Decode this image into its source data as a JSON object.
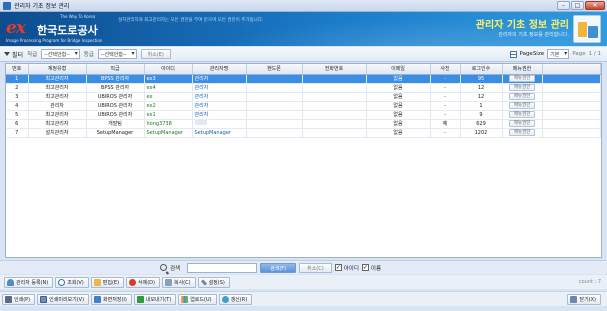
{
  "window": {
    "title": "관리자 기초 정보 관리"
  },
  "banner": {
    "logo_ex": "ex",
    "logo_kor": "한국도로공사",
    "logo_tag": "The Way To Korea",
    "logo_eng": "Image Processing Program for Bridge Inspection",
    "message": "설치관리자와 최고관리자는 모든 권한을 부여 받으며 모든 권한이 추가됩니다.",
    "title": "관리자 기초 정보 관리",
    "subtitle": "관리자의 기초 정보를 관리합니다."
  },
  "filter": {
    "filter_label": "필터",
    "rank_label": "직급",
    "rank_value": "--선택안함--",
    "level_label": "등급",
    "level_value": "--선택안함--",
    "cancel_label": "취소(E)",
    "pagesize_label": "PageSize",
    "pagesize_value": "기본",
    "page_label": "Page",
    "page_value": "1 / 1"
  },
  "table": {
    "headers": [
      "번호",
      "계정유형",
      "직급",
      "아이디",
      "관리자명",
      "핸드폰",
      "전화번호",
      "이메일",
      "사진",
      "로그인수",
      "메뉴권한"
    ],
    "rows": [
      {
        "no": "1",
        "type": "최고관리자",
        "rank": "BPSS 관리자",
        "id": "ex3",
        "name": "관리자",
        "phone": "",
        "tel": "",
        "email": "없음",
        "photo": "-",
        "logins": "95",
        "menu": "메뉴권한"
      },
      {
        "no": "2",
        "type": "최고관리자",
        "rank": "BPSS 관리자",
        "id": "ex4",
        "name": "관리자",
        "phone": "",
        "tel": "",
        "email": "없음",
        "photo": "-",
        "logins": "12",
        "menu": "메뉴권한"
      },
      {
        "no": "3",
        "type": "최고관리자",
        "rank": "UBIROS 관리자",
        "id": "ex",
        "name": "관리자",
        "phone": "",
        "tel": "",
        "email": "없음",
        "photo": "-",
        "logins": "12",
        "menu": "메뉴권한"
      },
      {
        "no": "4",
        "type": "관리자",
        "rank": "UBIROS 관리자",
        "id": "ex2",
        "name": "관리자",
        "phone": "",
        "tel": "",
        "email": "없음",
        "photo": "-",
        "logins": "1",
        "menu": "메뉴권한"
      },
      {
        "no": "5",
        "type": "최고관리자",
        "rank": "UBIROS 관리자",
        "id": "ex1",
        "name": "관리자",
        "phone": "",
        "tel": "",
        "email": "없음",
        "photo": "-",
        "logins": "9",
        "menu": "메뉴권한"
      },
      {
        "no": "6",
        "type": "최고관리자",
        "rank": "개발팀",
        "id": "hong3738",
        "name": "",
        "phone": "",
        "tel": "",
        "email": "없음",
        "photo": "예",
        "logins": "629",
        "menu": "메뉴권한"
      },
      {
        "no": "7",
        "type": "설치관리자",
        "rank": "SetupManager",
        "id": "SetupManager",
        "name": "SetupManager",
        "phone": "",
        "tel": "",
        "email": "없음",
        "photo": "-",
        "logins": "1202",
        "menu": "메뉴권한"
      }
    ]
  },
  "search": {
    "label": "검색",
    "search_button": "검색(F)",
    "cancel_button": "취소(C)",
    "chk_id": "아이디",
    "chk_name": "이름"
  },
  "toolbar1": {
    "register": "관리자 등록(N)",
    "view": "조회(V)",
    "edit": "편집(E)",
    "delete": "삭제(D)",
    "copy": "복사(C)",
    "settings": "설정(S)",
    "count": "count : 7"
  },
  "toolbar2": {
    "print": "인쇄(P)",
    "preview": "인쇄미리보기(V)",
    "screen": "화면저장(I)",
    "export": "내보내기(T)",
    "chart": "업로드(U)",
    "refresh": "갱신(R)",
    "close": "닫기(X)"
  }
}
